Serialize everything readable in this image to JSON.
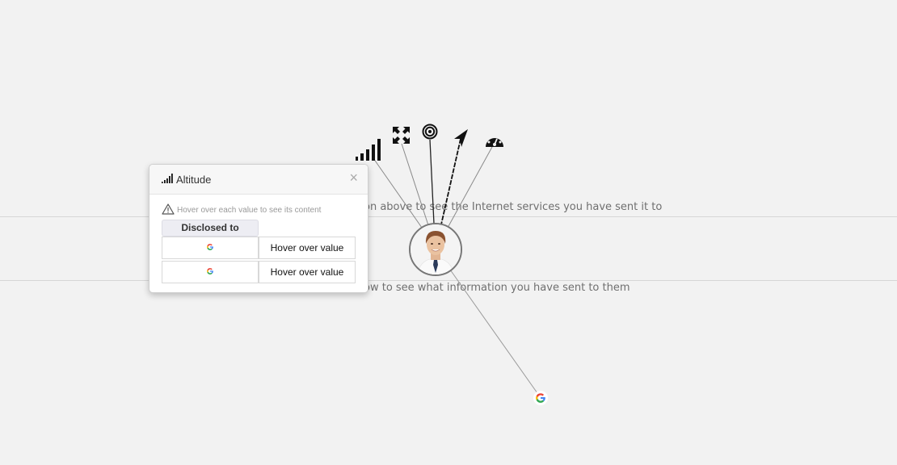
{
  "background": {
    "hint_top": "on above to see the Internet services you have sent it to",
    "hint_bottom": "ow to see what information you have sent to them"
  },
  "sensors": [
    {
      "name": "altitude-signal-icon"
    },
    {
      "name": "fullscreen-arrows-icon"
    },
    {
      "name": "target-icon"
    },
    {
      "name": "location-arrow-icon"
    },
    {
      "name": "speedometer-icon"
    }
  ],
  "central_node": {
    "name": "user-avatar"
  },
  "service_node": {
    "name": "google-service-icon"
  },
  "popup": {
    "title": "Altitude",
    "close_symbol": "×",
    "note": "Hover over each value to see its content",
    "column_header": "Disclosed to",
    "rows": [
      {
        "service_icon": "google-icon",
        "value": "Hover over value"
      },
      {
        "service_icon": "google-icon",
        "value": "Hover over value"
      }
    ]
  },
  "colors": {
    "background": "#f2f2f2",
    "link_line": "#8a8a8a",
    "active_link": "#111111",
    "google_blue": "#4285F4",
    "google_red": "#EA4335",
    "google_yellow": "#FBBC05",
    "google_green": "#34A853"
  }
}
